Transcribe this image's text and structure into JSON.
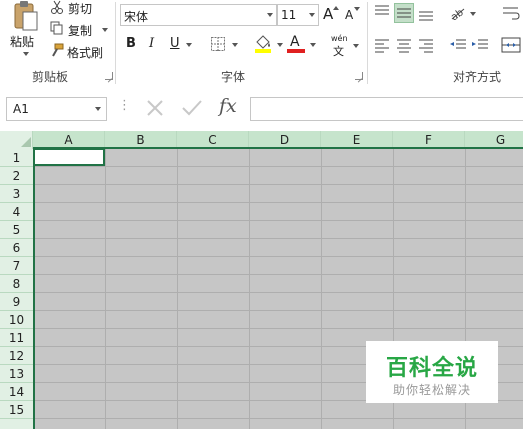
{
  "clipboard": {
    "paste_label": "粘贴",
    "cut_label": "剪切",
    "copy_label": "复制",
    "format_painter_label": "格式刷",
    "group_label": "剪贴板"
  },
  "font": {
    "font_name": "宋体",
    "font_size": "11",
    "grow_label": "A",
    "shrink_label": "A",
    "bold_label": "B",
    "italic_label": "I",
    "underline_label": "U",
    "font_color_label": "A",
    "phonetic_top": "wén",
    "phonetic_bottom": "文",
    "group_label": "字体",
    "fill_color": "#ffff00",
    "font_color": "#e02020"
  },
  "alignment": {
    "group_label": "对齐方式"
  },
  "formula_bar": {
    "name_box": "A1",
    "fx_label": "fx",
    "formula_value": ""
  },
  "columns": [
    "A",
    "B",
    "C",
    "D",
    "E",
    "F",
    "G"
  ],
  "rows": [
    "1",
    "2",
    "3",
    "4",
    "5",
    "6",
    "7",
    "8",
    "9",
    "10",
    "11",
    "12",
    "13",
    "14",
    "15"
  ],
  "watermark": {
    "title": "百科全说",
    "subtitle": "助你轻松解决"
  },
  "colors": {
    "accent": "#217346",
    "header_bg": "#e1f0e4",
    "cell_fill": "#c6c6c6"
  }
}
